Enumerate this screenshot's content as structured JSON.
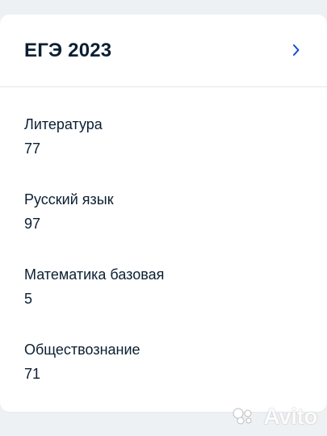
{
  "card": {
    "title": "ЕГЭ 2023",
    "icons": {
      "chevron": "chevron-right-icon"
    },
    "items": [
      {
        "label": "Литература",
        "value": "77"
      },
      {
        "label": "Русский язык",
        "value": "97"
      },
      {
        "label": "Математика базовая",
        "value": "5"
      },
      {
        "label": "Обществознание",
        "value": "71"
      }
    ]
  },
  "watermark": {
    "text": "Avito"
  },
  "colors": {
    "background": "#eef1f4",
    "card": "#ffffff",
    "text": "#0b1f33",
    "accent": "#0d4cd3",
    "divider": "#e3e6ea"
  }
}
